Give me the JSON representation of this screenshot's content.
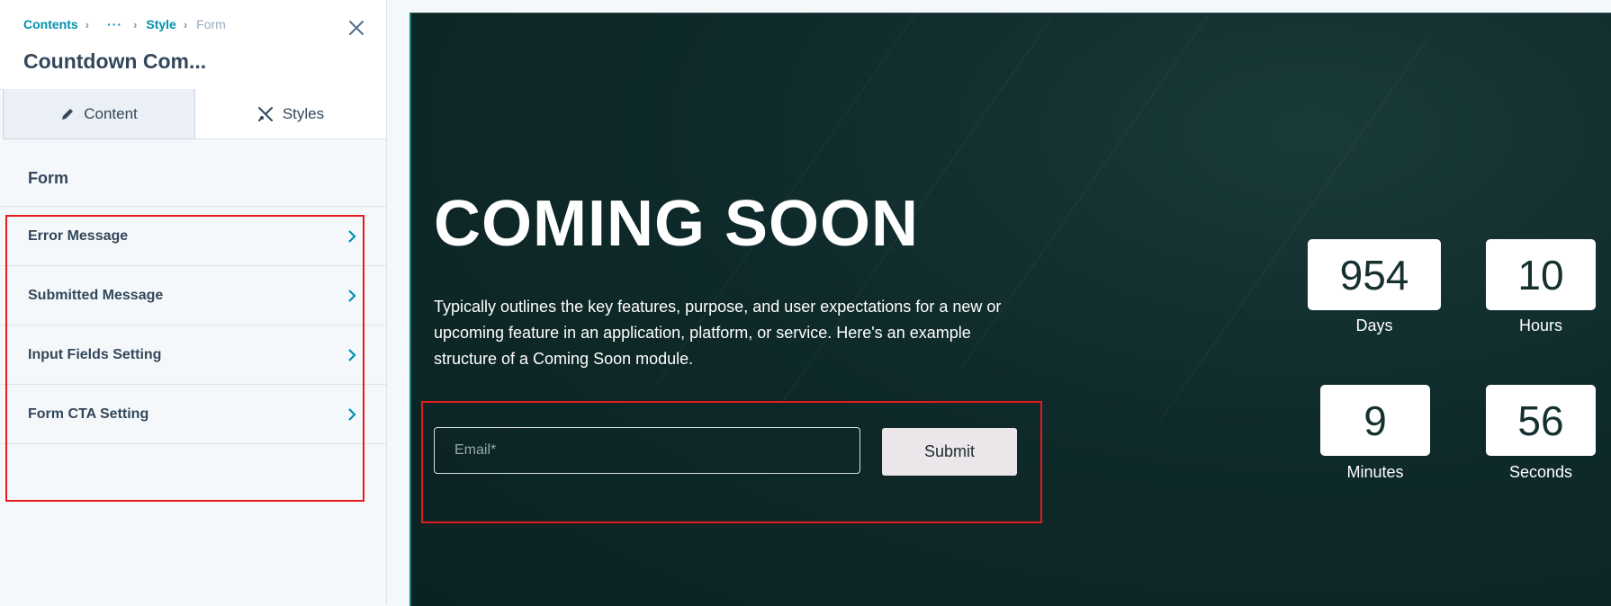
{
  "breadcrumb": {
    "contents": "Contents",
    "ellipsis": "···",
    "style": "Style",
    "form": "Form"
  },
  "panel": {
    "title": "Countdown Com...",
    "tabs": [
      {
        "label": "Content",
        "icon": "pencil-icon"
      },
      {
        "label": "Styles",
        "icon": "brush-icon"
      }
    ],
    "section_title": "Form",
    "menu_items": [
      {
        "label": "Error Message"
      },
      {
        "label": "Submitted Message"
      },
      {
        "label": "Input Fields Setting"
      },
      {
        "label": "Form CTA Setting"
      }
    ]
  },
  "preview": {
    "heading": "COMING SOON",
    "description": "Typically outlines the key features, purpose, and user expectations for a new or upcoming feature in an application, platform, or service. Here's an example structure of a Coming Soon module.",
    "email_placeholder": "Email*",
    "submit_label": "Submit",
    "countdown": {
      "days": {
        "value": "954",
        "label": "Days"
      },
      "hours": {
        "value": "10",
        "label": "Hours"
      },
      "minutes": {
        "value": "9",
        "label": "Minutes"
      },
      "seconds": {
        "value": "56",
        "label": "Seconds"
      }
    }
  },
  "colors": {
    "accent": "#0091ae",
    "highlight": "#e41b1b",
    "preview_bg": "#0f2a2a"
  }
}
